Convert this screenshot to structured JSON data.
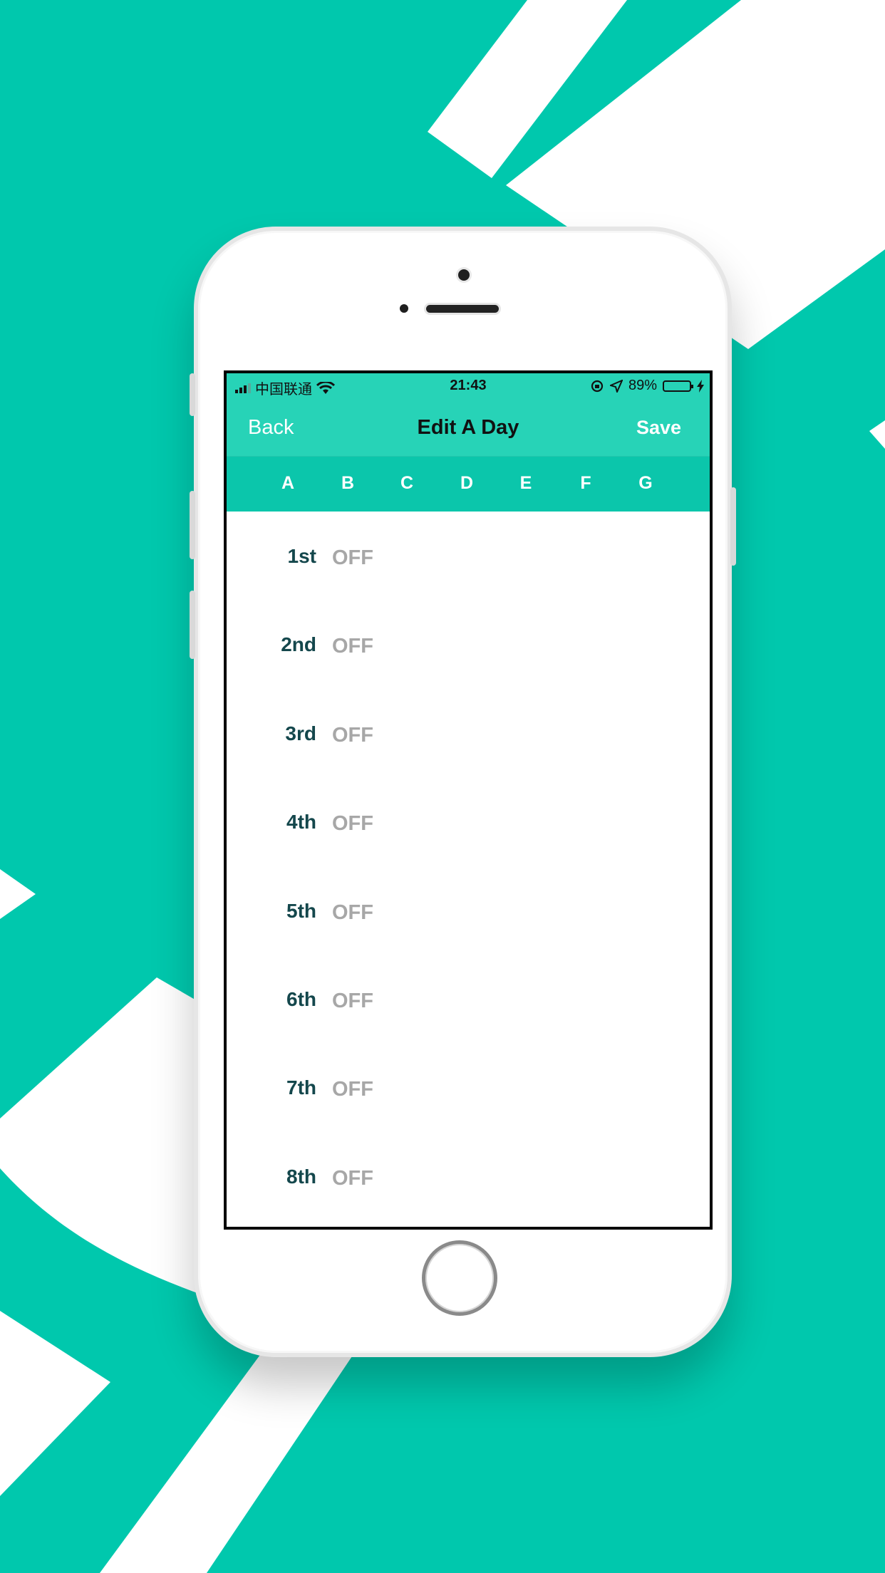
{
  "colors": {
    "background": "#00C8AD",
    "nav_bar": "#27D3B7",
    "tab_bar": "#0BC6AB",
    "period_text": "#14474C",
    "off_text": "#A7A7A7",
    "battery_fill": "#4CD964"
  },
  "status_bar": {
    "carrier": "中国联通",
    "time": "21:43",
    "battery_percent": "89%",
    "battery_level": 0.89,
    "icons": [
      "signal-icon",
      "wifi-icon",
      "rotation-lock-icon",
      "location-icon",
      "battery-icon",
      "charging-icon"
    ]
  },
  "nav": {
    "back_label": "Back",
    "title": "Edit A Day",
    "save_label": "Save"
  },
  "tabs": [
    "A",
    "B",
    "C",
    "D",
    "E",
    "F",
    "G"
  ],
  "periods": [
    {
      "label": "1st",
      "state": "OFF"
    },
    {
      "label": "2nd",
      "state": "OFF"
    },
    {
      "label": "3rd",
      "state": "OFF"
    },
    {
      "label": "4th",
      "state": "OFF"
    },
    {
      "label": "5th",
      "state": "OFF"
    },
    {
      "label": "6th",
      "state": "OFF"
    },
    {
      "label": "7th",
      "state": "OFF"
    },
    {
      "label": "8th",
      "state": "OFF"
    }
  ]
}
